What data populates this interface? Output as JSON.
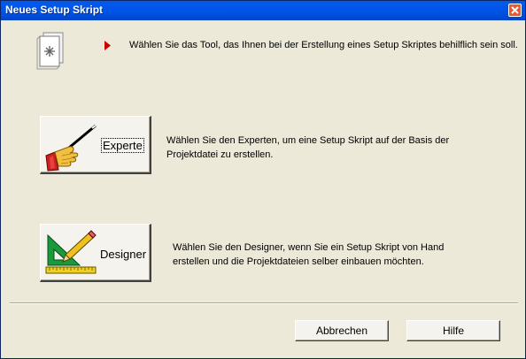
{
  "window": {
    "title": "Neues Setup Skript"
  },
  "intro": {
    "text": "Wählen Sie das Tool, das Ihnen bei der Erstellung eines Setup Skriptes behilflich sein soll."
  },
  "expert": {
    "label": "Experte",
    "description_line1": "Wählen Sie den Experten, um eine Setup Skript auf der Basis der",
    "description_line2": "Projektdatei zu erstellen."
  },
  "designer": {
    "label": "Designer",
    "description_line1": "Wählen Sie den Designer, wenn Sie ein Setup Skript von Hand",
    "description_line2": "erstellen und die Projektdateien selber einbauen möchten."
  },
  "footer": {
    "cancel_label": "Abbrechen",
    "help_label": "Hilfe"
  },
  "colors": {
    "titlebar": "#0054e3",
    "dialog_bg": "#ece9d8",
    "close_button": "#e35a33",
    "arrow": "#cc0000"
  },
  "icons": {
    "intro": "document-star-icon",
    "pointer": "red-triangle-arrow-icon",
    "expert": "hand-with-wand-icon",
    "designer": "set-square-pencil-icon",
    "close": "close-icon"
  }
}
